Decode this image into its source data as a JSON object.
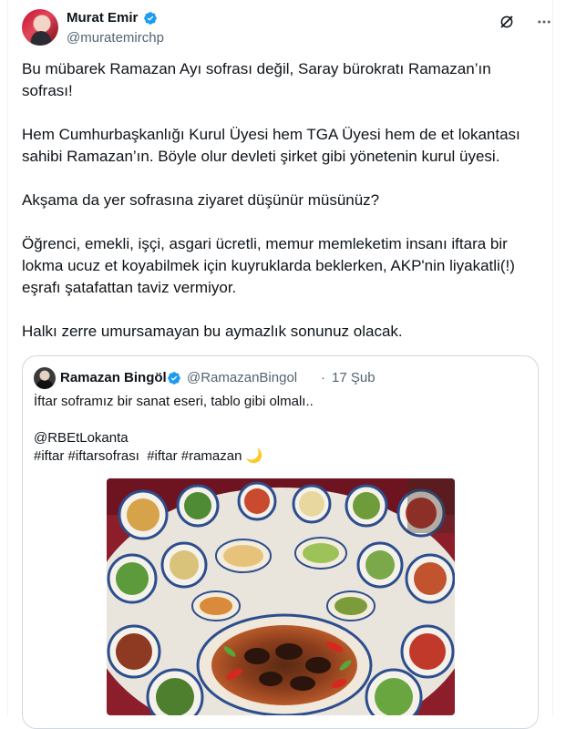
{
  "tweet": {
    "author_name": "Murat Emir",
    "author_handle": "@muratemirchp",
    "text": "Bu mübarek Ramazan Ayı sofrası değil, Saray bürokratı Ramazan’ın sofrası!\n\nHem Cumhurbaşkanlığı Kurul Üyesi hem TGA Üyesi hem de et lokantası sahibi Ramazan’ın. Böyle olur devleti şirket gibi yönetenin kurul üyesi.\n\nAkşama da yer sofrasına ziyaret düşünür müsünüz?\n\nÖğrenci, emekli, işçi, asgari ücretli, memur memleketim insanı iftara bir lokma ucuz et koyabilmek için kuyruklarda beklerken, AKP'nin liyakatli(!) eşrafı şatafattan taviz vermiyor.\n\nHalkı zerre umursamayan bu aymazlık sonunuz olacak."
  },
  "quoted_tweet": {
    "author_name": "Ramazan Bingöl",
    "author_handle": "@RamazanBingol",
    "separator": "·",
    "date": "17 Şub",
    "text": "İftar soframız bir sanat eseri, tablo gibi olmalı..\n\n@RBEtLokanta\n#iftar #iftarsofrası  #iftar #ramazan 🌙"
  },
  "icons": {
    "verified": "verified-badge-icon",
    "grok": "grok-icon",
    "more": "more-options-icon"
  },
  "colors": {
    "verified_blue": "#1d9bf0",
    "secondary_text": "#536471",
    "border": "#cfd9de"
  }
}
